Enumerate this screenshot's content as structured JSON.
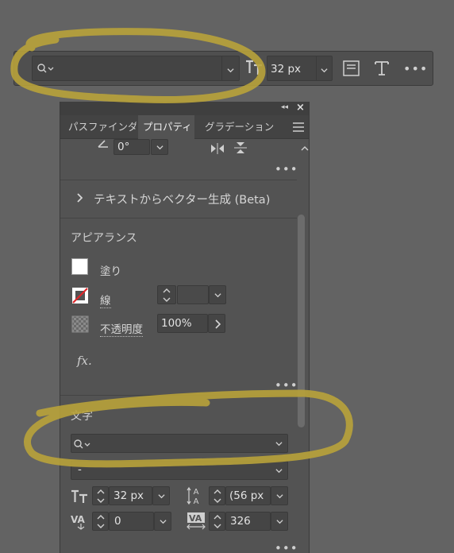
{
  "toolbar": {
    "font_size_value": "32 px",
    "more_label": "•••"
  },
  "panel": {
    "tabs": [
      {
        "label": "パスファインダー"
      },
      {
        "label": "プロパティ"
      },
      {
        "label": "グラデーション"
      }
    ],
    "rotate_value": "0°",
    "more_label": "•••",
    "text_to_vector": {
      "label": "テキストからベクター生成 (Beta)"
    },
    "appearance": {
      "title": "アピアランス",
      "fill_label": "塗り",
      "stroke_label": "線",
      "opacity_label": "不透明度",
      "opacity_value": "100%",
      "fx_label": "fx."
    },
    "character": {
      "title": "文字",
      "font_style_value": "-",
      "font_size_value": "32 px",
      "leading_value": "(56 px",
      "kerning_value": "0",
      "tracking_value": "326"
    }
  },
  "colors": {
    "highlighter": "#b8a23a",
    "stroke_none_red": "#e0262a"
  }
}
